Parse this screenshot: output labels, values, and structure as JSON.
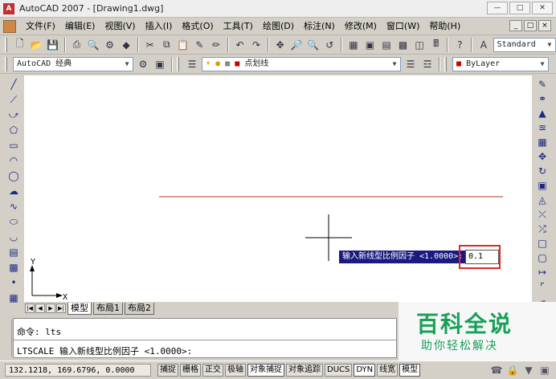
{
  "window": {
    "title": "AutoCAD 2007 - [Drawing1.dwg]",
    "app_icon": "autocad-logo-icon",
    "controls": [
      "minimize",
      "maximize",
      "close"
    ]
  },
  "menubar": {
    "items": [
      "文件(F)",
      "编辑(E)",
      "视图(V)",
      "插入(I)",
      "格式(O)",
      "工具(T)",
      "绘图(D)",
      "标注(N)",
      "修改(M)",
      "窗口(W)",
      "帮助(H)"
    ]
  },
  "toolbar_standard": {
    "text_style": "Standard"
  },
  "toolbar_layers": {
    "workspace": "AutoCAD 经典",
    "layer": "点划线",
    "color": "ByLayer",
    "color_swatch": "#cc0000",
    "layer_swatch": "#cc0000"
  },
  "canvas": {
    "background": "#ffffff",
    "line_color": "#b03020",
    "ucs_x_label": "X",
    "ucs_y_label": "Y"
  },
  "dynamic_input": {
    "prompt": "输入新线型比例因子 <1.0000>:",
    "value": "0.1"
  },
  "layout_tabs": [
    "模型",
    "布局1",
    "布局2"
  ],
  "command_window": {
    "line1": "命令: lts",
    "line2": "LTSCALE 输入新线型比例因子 <1.0000>:"
  },
  "statusbar": {
    "coords": "132.1218, 169.6796, 0.0000",
    "toggles": [
      {
        "label": "捕捉",
        "on": false
      },
      {
        "label": "栅格",
        "on": false
      },
      {
        "label": "正交",
        "on": false
      },
      {
        "label": "极轴",
        "on": false
      },
      {
        "label": "对象捕捉",
        "on": true
      },
      {
        "label": "对象追踪",
        "on": false
      },
      {
        "label": "DUCS",
        "on": false
      },
      {
        "label": "DYN",
        "on": true
      },
      {
        "label": "线宽",
        "on": false
      },
      {
        "label": "模型",
        "on": true
      }
    ]
  },
  "watermark": {
    "title": "百科全说",
    "subtitle": "助你轻松解决"
  }
}
